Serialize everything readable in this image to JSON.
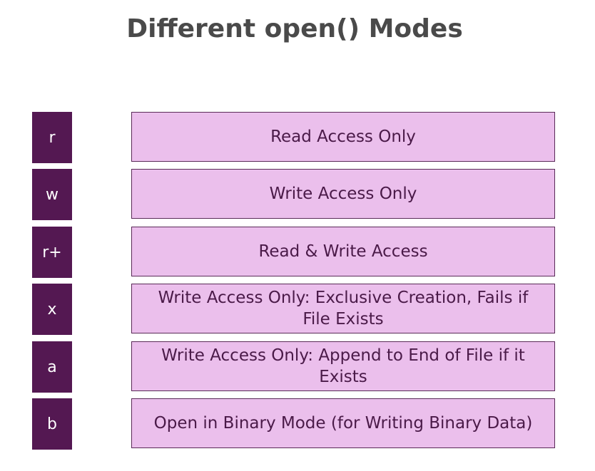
{
  "title": "Different open() Modes",
  "modes": [
    {
      "code": "r",
      "description": "Read Access Only"
    },
    {
      "code": "w",
      "description": "Write Access Only"
    },
    {
      "code": "r+",
      "description": "Read & Write Access"
    },
    {
      "code": "x",
      "description": "Write Access Only: Exclusive Creation, Fails if File Exists"
    },
    {
      "code": "a",
      "description": "Write Access Only: Append to End of File if it Exists"
    },
    {
      "code": "b",
      "description": "Open in Binary Mode (for Writing Binary Data)"
    }
  ],
  "colors": {
    "mode_box": "#541852",
    "desc_box": "#ebbfec",
    "title": "#4a4a4a"
  }
}
